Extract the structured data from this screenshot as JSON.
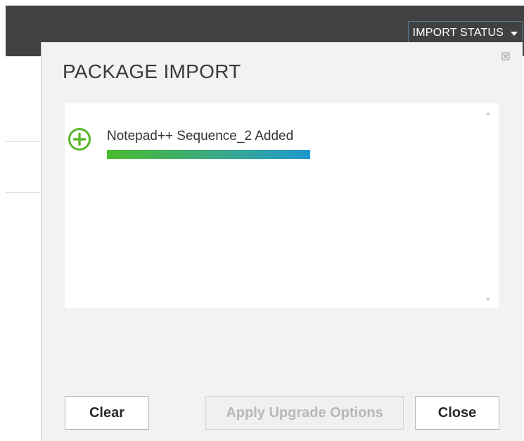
{
  "header": {
    "import_status_label": "IMPORT STATUS",
    "dropdown_icon": "caret-down-icon"
  },
  "dialog": {
    "title": "PACKAGE IMPORT",
    "close_icon": "close-icon",
    "items": [
      {
        "label": "Notepad++ Sequence_2 Added",
        "icon": "add-circle-icon",
        "icon_color": "#5bb52c",
        "progress": 1.0
      }
    ],
    "buttons": {
      "clear_label": "Clear",
      "apply_label": "Apply Upgrade Options",
      "close_label": "Close"
    }
  },
  "colors": {
    "topbar": "#414141",
    "dialog_bg": "#f2f2f2",
    "progress_start": "#4aba2f",
    "progress_end": "#1f98cf"
  }
}
